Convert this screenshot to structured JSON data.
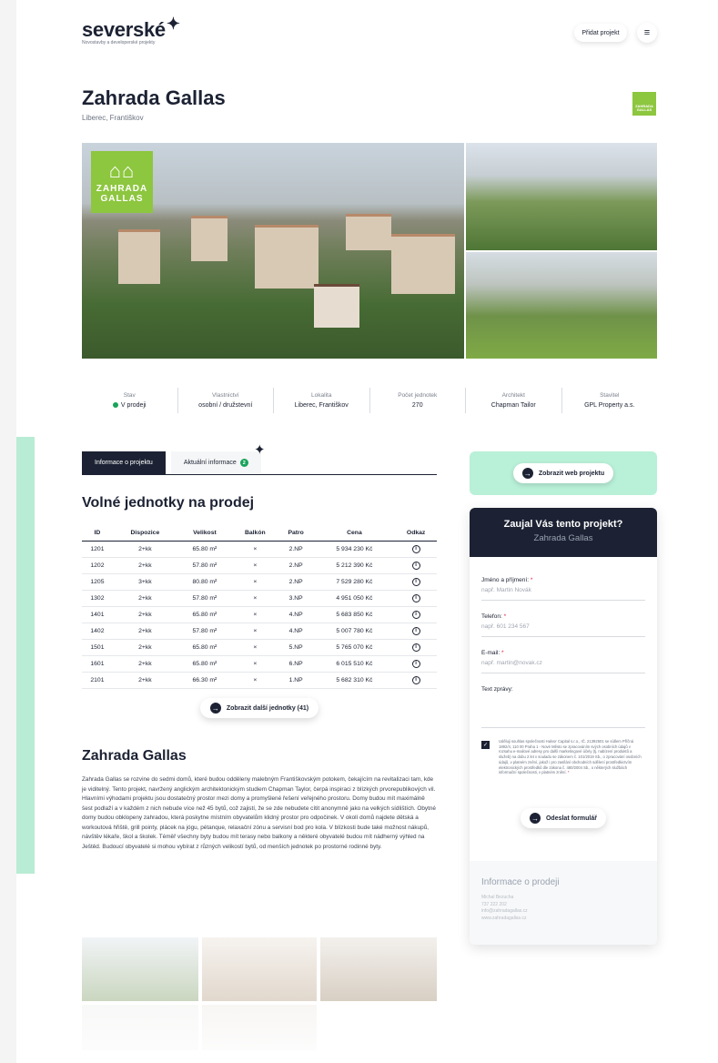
{
  "header": {
    "logo": "severské",
    "logo_star": "✦",
    "tagline": "Novostavby a developerské projekty",
    "add_project": "Přidat projekt",
    "menu_icon": "hamburger-icon"
  },
  "project": {
    "title": "Zahrada Gallas",
    "location": "Liberec, Františkov",
    "badge_line1": "ZAHRADA",
    "badge_line2": "GALLAS"
  },
  "stats": [
    {
      "label": "Stav",
      "value": "V prodeji"
    },
    {
      "label": "Vlastnictví",
      "value": "osobní / družstevní"
    },
    {
      "label": "Lokalita",
      "value": "Liberec, Františkov"
    },
    {
      "label": "Počet jednotek",
      "value": "270"
    },
    {
      "label": "Architekt",
      "value": "Chapman Tailor"
    },
    {
      "label": "Stavitel",
      "value": "GPL Property a.s."
    }
  ],
  "tabs": {
    "info": "Informace o projektu",
    "news": "Aktuální informace",
    "news_count": "2"
  },
  "units": {
    "title": "Volné jednotky na prodej",
    "headers": [
      "ID",
      "Dispozice",
      "Velikost",
      "Balkón",
      "Patro",
      "Cena",
      "Odkaz"
    ],
    "rows": [
      [
        "1201",
        "2+kk",
        "65.80 m²",
        "×",
        "2.NP",
        "5 934 230 Kč"
      ],
      [
        "1202",
        "2+kk",
        "57.80 m²",
        "×",
        "2.NP",
        "5 212 390 Kč"
      ],
      [
        "1205",
        "3+kk",
        "80.80 m²",
        "×",
        "2.NP",
        "7 529 280 Kč"
      ],
      [
        "1302",
        "2+kk",
        "57.80 m²",
        "×",
        "3.NP",
        "4 951 050 Kč"
      ],
      [
        "1401",
        "2+kk",
        "65.80 m²",
        "×",
        "4.NP",
        "5 683 850 Kč"
      ],
      [
        "1402",
        "2+kk",
        "57.80 m²",
        "×",
        "4.NP",
        "5 007 780 Kč"
      ],
      [
        "1501",
        "2+kk",
        "65.80 m²",
        "×",
        "5.NP",
        "5 765 070 Kč"
      ],
      [
        "1601",
        "2+kk",
        "65.80 m²",
        "×",
        "6.NP",
        "6 015 510 Kč"
      ],
      [
        "2101",
        "2+kk",
        "66.30 m²",
        "×",
        "1.NP",
        "5 682 310 Kč"
      ]
    ],
    "more_button": "Zobrazit další jednotky (41)"
  },
  "about": {
    "title": "Zahrada Gallas",
    "text": "Zahrada Gallas se rozvine do sedmi domů, které budou odděleny malebným Františkovským potokem, čekajícím na revitalizaci tam, kde je viditelný. Tento projekt, navržený anglickým architektonickým studiem Chapman Taylor, čerpá inspiraci z blízkých prvorepublikových vil. Hlavními výhodami projektu jsou dostatečný prostor mezi domy a promyšlené řešení veřejného prostoru. Domy budou mít maximálně šest podlaží a v každém z nich nebude více než 45 bytů, což zajistí, že se zde nebudete cítit anonymně jako na velkých sídlištích. Obytné domy budou obklopeny zahradou, která poskytne místním obyvatelům klidný prostor pro odpočinek. V okolí domů najdete dětská a workoutová hřiště, grill pointy, plácek na jógu, pétanque, relaxační zónu a servisní bod pro kola. V blízkosti bude také možnost nákupů, návštěv lékaře, škol a školek. Téměř všechny byty budou mít terasy nebo balkony a některé obyvatelé budou mít nádherný výhled na Ještěd. Budoucí obyvatelé si mohou vybírat z různých velikostí bytů, od menších jednotek po prostorné rodinné byty."
  },
  "web_button": "Zobrazit web projektu",
  "form": {
    "question": "Zaujal Vás tento projekt?",
    "project": "Zahrada Gallas",
    "name_label": "Jméno a příjmení:",
    "name_ph": "např. Martin Novák",
    "phone_label": "Telefon:",
    "phone_ph": "např. 601 234 567",
    "email_label": "E-mail:",
    "email_ph": "např. martin@novak.cz",
    "message_label": "Text zprávy:",
    "required": "*",
    "consent": "Uděluji souhlas společnosti Halvor Capital s.r.o., IČ. 21392501 se sídlem Příčná 1892/4, 110 00 Praha 1 - Nové Město se zpracováním svých osobních údajů v rozsahu e-mailové adresy pro další marketingové účely (tj. nabízení produktů a služeb) na dobu 2 let v souladu se zákonem č. 101/2019 Sb., o zpracování osobních údajů, v platném znění, jakož i pro zasílání obchodních sdělení prostředkictvím elektronických prostředků dle zákona č. 480/2004 Sb., o některých službách informační společnosti, v platném znění.",
    "submit": "Odeslat formulář"
  },
  "sales": {
    "title": "Informace o prodeji",
    "name": "Michal Bezucha",
    "phone": "737 222 202",
    "email": "info@zahradagallas.cz",
    "web": "www.zahradagallas.cz"
  },
  "colors": {
    "brand_dark": "#1c2233",
    "brand_green": "#8dc63f",
    "mint": "#b9f0d8",
    "status_green": "#1aa35a"
  }
}
